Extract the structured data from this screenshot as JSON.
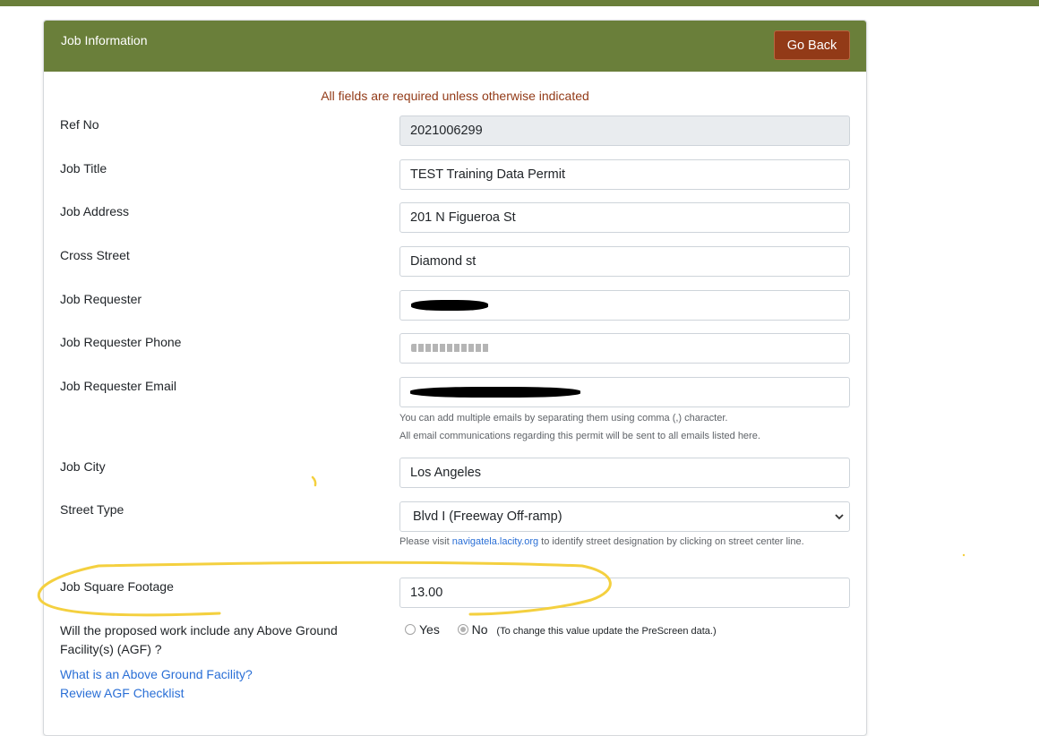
{
  "header": {
    "title": "Job Information",
    "go_back_label": "Go Back"
  },
  "form": {
    "required_note": "All fields are required unless otherwise indicated",
    "ref_no": {
      "label": "Ref No",
      "value": "2021006299"
    },
    "job_title": {
      "label": "Job Title",
      "value": "TEST Training Data Permit"
    },
    "job_address": {
      "label": "Job Address",
      "value": "201 N Figueroa St"
    },
    "cross_street": {
      "label": "Cross Street",
      "value": "Diamond st"
    },
    "job_requester": {
      "label": "Job Requester",
      "value": ""
    },
    "job_requester_phone": {
      "label": "Job Requester Phone",
      "value": ""
    },
    "job_requester_email": {
      "label": "Job Requester Email",
      "value": "",
      "help_1": "You can add multiple emails by separating them using comma (,) character.",
      "help_2": "All email communications regarding this permit will be sent to all emails listed here."
    },
    "job_city": {
      "label": "Job City",
      "value": "Los Angeles"
    },
    "street_type": {
      "label": "Street Type",
      "selected": "Blvd I (Freeway Off-ramp)",
      "help_prefix": "Please visit",
      "help_link": "navigatela.lacity.org",
      "help_suffix": "to identify street designation by clicking on street center line."
    },
    "job_square_footage": {
      "label": "Job Square Footage",
      "value": "13.00"
    },
    "agf": {
      "label_line1": "Will the proposed work include any Above Ground",
      "label_line2": "Facility(s) (AGF) ?",
      "option_yes": "Yes",
      "option_no": "No",
      "selected": "No",
      "note": "(To change this value update the PreScreen data.)"
    },
    "links": {
      "what_is_agf": "What is an Above Ground Facility?",
      "review_checklist": "Review AGF Checklist"
    }
  },
  "colors": {
    "header_green": "#6a7f3a",
    "go_back_brown": "#923a17",
    "link_blue": "#2a6fd6",
    "highlight_yellow": "#f4d03f"
  }
}
